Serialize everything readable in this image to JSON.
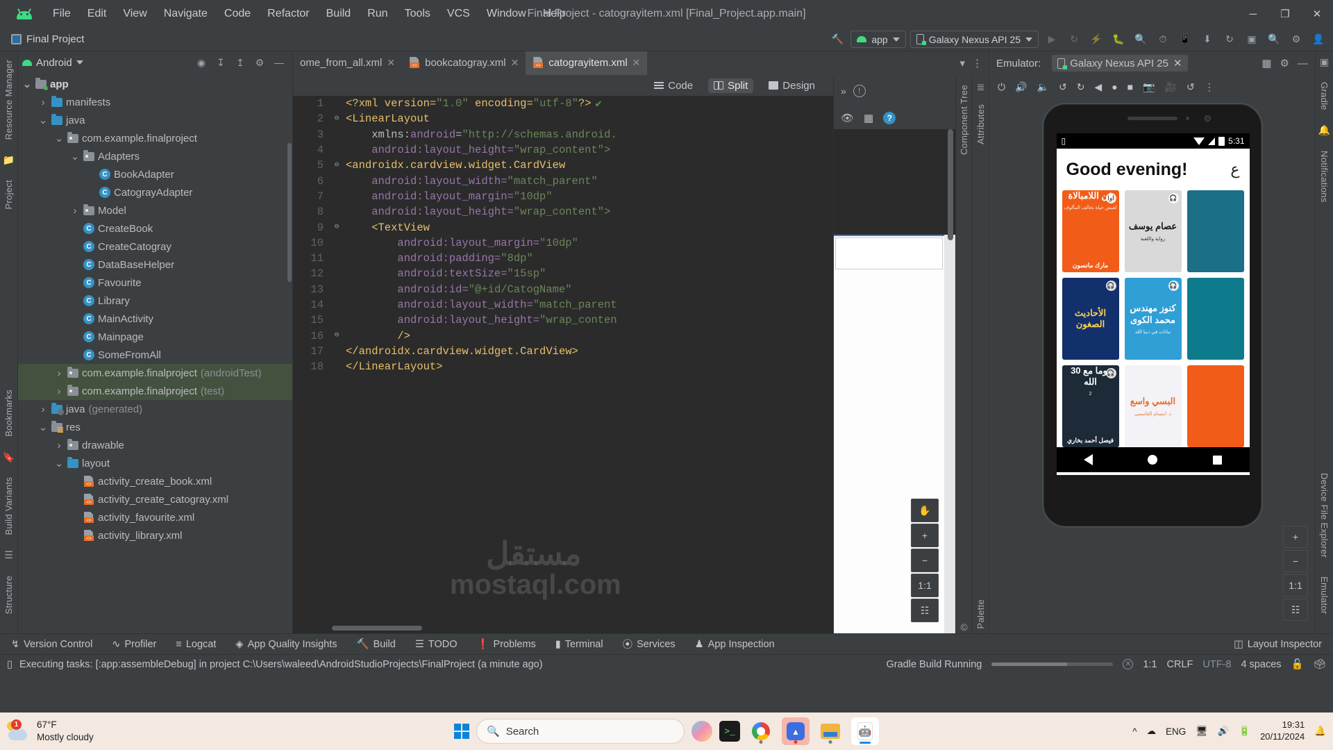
{
  "window": {
    "title": "Final Project - catograyitem.xml [Final_Project.app.main]",
    "minimize": "─",
    "maximize": "❐",
    "close": "✕"
  },
  "menubar": {
    "items": [
      "File",
      "Edit",
      "View",
      "Navigate",
      "Code",
      "Refactor",
      "Build",
      "Run",
      "Tools",
      "VCS",
      "Window",
      "Help"
    ]
  },
  "toolbar": {
    "project_name": "Final Project",
    "build_config": "app",
    "device": "Galaxy Nexus API 25",
    "icons": [
      "hammer-icon",
      "run-icon",
      "debug-icon",
      "profiler-icon",
      "bug-icon",
      "attach-debugger-icon",
      "inspect-icon",
      "sync-icon",
      "avd-icon",
      "sdk-icon",
      "search-icon",
      "settings-icon",
      "account-icon"
    ]
  },
  "project_panel": {
    "title": "Android",
    "header_icons": [
      "locate-icon",
      "expand-all-icon",
      "collapse-all-icon",
      "settings-icon",
      "hide-icon"
    ],
    "tree": [
      {
        "label": "app",
        "kind": "module",
        "depth": 0,
        "arrow": "expanded",
        "bold": true
      },
      {
        "label": "manifests",
        "kind": "folder-blue",
        "depth": 1,
        "arrow": "collapsed"
      },
      {
        "label": "java",
        "kind": "folder-blue",
        "depth": 1,
        "arrow": "expanded"
      },
      {
        "label": "com.example.finalproject",
        "kind": "package",
        "depth": 2,
        "arrow": "expanded"
      },
      {
        "label": "Adapters",
        "kind": "package",
        "depth": 3,
        "arrow": "expanded"
      },
      {
        "label": "BookAdapter",
        "kind": "class",
        "depth": 4,
        "arrow": "none"
      },
      {
        "label": "CatograyAdapter",
        "kind": "class",
        "depth": 4,
        "arrow": "none"
      },
      {
        "label": "Model",
        "kind": "package",
        "depth": 3,
        "arrow": "collapsed"
      },
      {
        "label": "CreateBook",
        "kind": "class",
        "depth": 3,
        "arrow": "none"
      },
      {
        "label": "CreateCatogray",
        "kind": "class",
        "depth": 3,
        "arrow": "none"
      },
      {
        "label": "DataBaseHelper",
        "kind": "class",
        "depth": 3,
        "arrow": "none"
      },
      {
        "label": "Favourite",
        "kind": "class",
        "depth": 3,
        "arrow": "none"
      },
      {
        "label": "Library",
        "kind": "class",
        "depth": 3,
        "arrow": "none"
      },
      {
        "label": "MainActivity",
        "kind": "class",
        "depth": 3,
        "arrow": "none"
      },
      {
        "label": "Mainpage",
        "kind": "class",
        "depth": 3,
        "arrow": "none"
      },
      {
        "label": "SomeFromAll",
        "kind": "class",
        "depth": 3,
        "arrow": "none"
      },
      {
        "label": "com.example.finalproject",
        "suffix": " (androidTest)",
        "kind": "package",
        "depth": 2,
        "arrow": "collapsed",
        "selected": true
      },
      {
        "label": "com.example.finalproject",
        "suffix": " (test)",
        "kind": "package",
        "depth": 2,
        "arrow": "collapsed",
        "selected": true
      },
      {
        "label": "java",
        "suffix": " (generated)",
        "kind": "folder-generated",
        "depth": 1,
        "arrow": "collapsed"
      },
      {
        "label": "res",
        "kind": "folder-res",
        "depth": 1,
        "arrow": "expanded"
      },
      {
        "label": "drawable",
        "kind": "package",
        "depth": 2,
        "arrow": "collapsed"
      },
      {
        "label": "layout",
        "kind": "folder-blue",
        "depth": 2,
        "arrow": "expanded"
      },
      {
        "label": "activity_create_book.xml",
        "kind": "xml",
        "depth": 3,
        "arrow": "none"
      },
      {
        "label": "activity_create_catogray.xml",
        "kind": "xml",
        "depth": 3,
        "arrow": "none"
      },
      {
        "label": "activity_favourite.xml",
        "kind": "xml",
        "depth": 3,
        "arrow": "none"
      },
      {
        "label": "activity_library.xml",
        "kind": "xml",
        "depth": 3,
        "arrow": "none"
      }
    ]
  },
  "left_rail": [
    "Resource Manager",
    "Project"
  ],
  "left_rail_bottom": [
    "Bookmarks",
    "Build Variants",
    "Structure"
  ],
  "right_rail": [
    "Gradle",
    "Notifications",
    "Device File Explorer",
    "Emulator"
  ],
  "editor": {
    "tabs": [
      {
        "label": "ome_from_all.xml",
        "active": false,
        "closable": true
      },
      {
        "label": "bookcatogray.xml",
        "active": false,
        "closable": true
      },
      {
        "label": "catograyitem.xml",
        "active": true,
        "closable": true
      }
    ],
    "overflow_icon": "chevron-down-icon",
    "more_icon": "more-vertical-icon",
    "modes": [
      {
        "label": "Code",
        "icon": "code-icon",
        "selected": false
      },
      {
        "label": "Split",
        "icon": "split-icon",
        "selected": true
      },
      {
        "label": "Design",
        "icon": "design-icon",
        "selected": false
      }
    ],
    "inspection_status": "✔",
    "lines": [
      {
        "n": 1,
        "fold": "",
        "segs": [
          {
            "t": "<?xml version=",
            "c": "k-decl"
          },
          {
            "t": "\"1.0\"",
            "c": "k-val"
          },
          {
            "t": " encoding=",
            "c": "k-decl"
          },
          {
            "t": "\"utf-8\"",
            "c": "k-val"
          },
          {
            "t": "?>",
            "c": "k-decl"
          }
        ]
      },
      {
        "n": 2,
        "fold": "⊖",
        "segs": [
          {
            "t": "<LinearLayout",
            "c": "k-tag"
          }
        ]
      },
      {
        "n": 3,
        "fold": "",
        "segs": [
          {
            "t": "    xmlns:",
            "c": "k-attrname"
          },
          {
            "t": "android",
            "c": "k-ns"
          },
          {
            "t": "=",
            "c": "k-eq"
          },
          {
            "t": "\"http://schemas.android.",
            "c": "k-val"
          }
        ]
      },
      {
        "n": 4,
        "fold": "",
        "segs": [
          {
            "t": "    android:layout_height=",
            "c": "k-ns"
          },
          {
            "t": "\"wrap_content\">",
            "c": "k-val"
          }
        ]
      },
      {
        "n": 5,
        "fold": "⊖",
        "segs": [
          {
            "t": "<androidx.cardview.widget.CardView",
            "c": "k-tag"
          }
        ]
      },
      {
        "n": 6,
        "fold": "",
        "segs": [
          {
            "t": "    android:layout_width=",
            "c": "k-ns"
          },
          {
            "t": "\"match_parent\"",
            "c": "k-val"
          }
        ]
      },
      {
        "n": 7,
        "fold": "",
        "segs": [
          {
            "t": "    android:layout_margin=",
            "c": "k-ns"
          },
          {
            "t": "\"10dp\"",
            "c": "k-val"
          }
        ]
      },
      {
        "n": 8,
        "fold": "",
        "segs": [
          {
            "t": "    android:layout_height=",
            "c": "k-ns"
          },
          {
            "t": "\"wrap_content\">",
            "c": "k-val"
          }
        ]
      },
      {
        "n": 9,
        "fold": "⊖",
        "segs": [
          {
            "t": "    <TextView",
            "c": "k-tag"
          }
        ]
      },
      {
        "n": 10,
        "fold": "",
        "segs": [
          {
            "t": "        android:layout_margin=",
            "c": "k-ns"
          },
          {
            "t": "\"10dp\"",
            "c": "k-val"
          }
        ]
      },
      {
        "n": 11,
        "fold": "",
        "segs": [
          {
            "t": "        android:padding=",
            "c": "k-ns"
          },
          {
            "t": "\"8dp\"",
            "c": "k-val"
          }
        ]
      },
      {
        "n": 12,
        "fold": "",
        "segs": [
          {
            "t": "        android:textSize=",
            "c": "k-ns"
          },
          {
            "t": "\"15sp\"",
            "c": "k-val"
          }
        ]
      },
      {
        "n": 13,
        "fold": "",
        "segs": [
          {
            "t": "        android:id=",
            "c": "k-ns"
          },
          {
            "t": "\"@+id/CatogName\"",
            "c": "k-ref"
          }
        ]
      },
      {
        "n": 14,
        "fold": "",
        "segs": [
          {
            "t": "        android:layout_width=",
            "c": "k-ns"
          },
          {
            "t": "\"match_parent",
            "c": "k-val"
          }
        ]
      },
      {
        "n": 15,
        "fold": "",
        "segs": [
          {
            "t": "        android:layout_height=",
            "c": "k-ns"
          },
          {
            "t": "\"wrap_conten",
            "c": "k-val"
          }
        ]
      },
      {
        "n": 16,
        "fold": "⊖",
        "segs": [
          {
            "t": "        />",
            "c": "k-tag"
          }
        ]
      },
      {
        "n": 17,
        "fold": "",
        "segs": [
          {
            "t": "</androidx.cardview.widget.CardView>",
            "c": "k-tag"
          }
        ]
      },
      {
        "n": 18,
        "fold": "",
        "segs": [
          {
            "t": "</LinearLayout>",
            "c": "k-tag"
          }
        ]
      }
    ]
  },
  "palette": {
    "label": "Palette",
    "component_tree_label": "Component Tree",
    "attributes_label": "Attributes",
    "icons": [
      "chevron-right-icon",
      "warning-icon",
      "eye-icon",
      "blueprint-icon",
      "help-icon"
    ],
    "zoom_tools": [
      "pan-icon",
      "zoom-in",
      "zoom-out",
      "1:1",
      "zoom-to-fit"
    ],
    "zoom_plus": "+",
    "zoom_minus": "−",
    "zoom_actual": "1:1"
  },
  "emulator": {
    "panel_label": "Emulator:",
    "tab_label": "Galaxy Nexus API 25",
    "close_icon": "close-icon",
    "toolbar_icons": [
      "power-icon",
      "volume-up-icon",
      "volume-down-icon",
      "rotate-left-icon",
      "rotate-right-icon",
      "back-icon",
      "home-icon",
      "overview-icon",
      "screenshot-icon",
      "record-icon",
      "history-icon",
      "more-icon"
    ],
    "side_tools": [
      "+",
      "−",
      "1:1",
      "fit-icon"
    ],
    "device": {
      "status_time": "5:31",
      "status_icons": [
        "sd-card-icon",
        "wifi-icon",
        "signal-icon",
        "battery-icon"
      ],
      "greeting": "Good evening!",
      "account_icon": "ع",
      "books": [
        {
          "title": "فن اللامبالاة",
          "sub": "لعيش حياة تخالف المألوف",
          "author": "مارك مانسون",
          "bg": "#f25c19",
          "fg": "#ffffff",
          "badge": "اوا"
        },
        {
          "title": "عصام يوسف",
          "sub": "رواية واللعبة",
          "author": "",
          "bg": "#d9d9d9",
          "fg": "#1a1a1a",
          "badge": "🎧"
        },
        {
          "title": "",
          "sub": "",
          "author": "",
          "bg": "#1b6f86",
          "fg": "#ffffff",
          "badge": ""
        },
        {
          "title": "الأحاديث الصغون",
          "sub": "",
          "author": "",
          "bg": "#12306b",
          "fg": "#ffd24d",
          "badge": "🎧"
        },
        {
          "title": "كنوز مهندس محمد الكوى",
          "sub": "نباتات في دنيا الله",
          "author": "",
          "bg": "#2f9fd6",
          "fg": "#ffffff",
          "badge": "🎧"
        },
        {
          "title": "",
          "sub": "",
          "author": "",
          "bg": "#0e7b8c",
          "fg": "#ffffff",
          "badge": ""
        },
        {
          "title": "30 يوما مع الله",
          "sub": "2",
          "author": "فيصل أحمد بخاري",
          "bg": "#1d2a38",
          "fg": "#ffffff",
          "badge": "🎧"
        },
        {
          "title": "البسي واسع",
          "sub": "د. ابتسام القاسمي",
          "author": "",
          "bg": "#f3f2f7",
          "fg": "#e8702a",
          "badge": ""
        },
        {
          "title": "",
          "sub": "",
          "author": "",
          "bg": "#f25c19",
          "fg": "#ffffff",
          "badge": ""
        }
      ],
      "nav": [
        "back-button",
        "home-button",
        "recents-button"
      ]
    }
  },
  "tool_windows": {
    "left": [
      {
        "label": "Version Control",
        "icon": "branch-icon"
      },
      {
        "label": "Profiler",
        "icon": "profiler-icon"
      },
      {
        "label": "Logcat",
        "icon": "logcat-icon"
      },
      {
        "label": "App Quality Insights",
        "icon": "diamond-icon"
      },
      {
        "label": "Build",
        "icon": "hammer-icon"
      },
      {
        "label": "TODO",
        "icon": "list-icon"
      },
      {
        "label": "Problems",
        "icon": "error-icon"
      },
      {
        "label": "Terminal",
        "icon": "terminal-icon"
      },
      {
        "label": "Services",
        "icon": "services-icon"
      },
      {
        "label": "App Inspection",
        "icon": "inspection-icon"
      }
    ],
    "right": [
      {
        "label": "Layout Inspector",
        "icon": "layout-inspector-icon"
      }
    ]
  },
  "statusbar": {
    "message": "Executing tasks: [:app:assembleDebug] in project C:\\Users\\waleed\\AndroidStudioProjects\\FinalProject (a minute ago)",
    "build_status": "Gradle Build Running",
    "caret": "1:1",
    "line_sep": "CRLF",
    "encoding": "UTF-8",
    "indent": "4 spaces",
    "icons": [
      "console-icon",
      "cancel-icon",
      "lock-icon",
      "notification-icon"
    ]
  },
  "taskbar": {
    "weather_temp": "67°F",
    "weather_desc": "Mostly cloudy",
    "weather_badge": "1",
    "search_placeholder": "Search",
    "search_icon": "search-icon",
    "apps": [
      "start-icon",
      "copilot-icon",
      "terminal-icon",
      "chrome-icon",
      "android-studio-icon",
      "file-explorer-icon",
      "emulator-icon"
    ],
    "tray": [
      "chevron-up-icon",
      "onedrive-icon",
      "lang-icon",
      "remote-icon",
      "volume-icon",
      "battery-icon"
    ],
    "language": "ENG",
    "time": "19:31",
    "date": "20/11/2024",
    "notification_icon": "bell-icon"
  },
  "watermark": {
    "a": "مستقل",
    "b": "mostaql.com"
  }
}
